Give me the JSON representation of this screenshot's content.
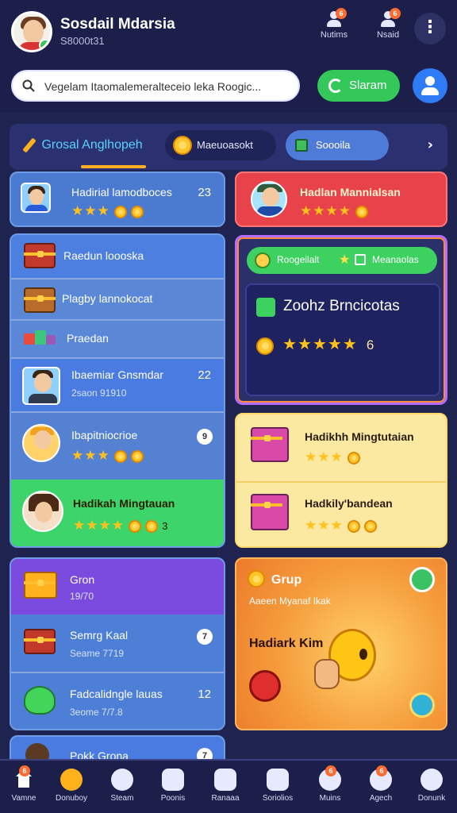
{
  "header": {
    "title": "Sosdail Mdarsia",
    "subtitle": "S8000t31",
    "actions": [
      {
        "label": "Nutims",
        "icon": "person-icon",
        "badge": "6"
      },
      {
        "label": "Nsaid",
        "icon": "person-icon",
        "badge": "6"
      }
    ],
    "more_icon": "⋮"
  },
  "search": {
    "placeholder": "Vegelam Itaomalemeralteceio leka Roogic...",
    "button_label": "Slaram"
  },
  "tabs": [
    {
      "label": "Grosal Anglhopeh"
    },
    {
      "label": "Maeuoasokt"
    },
    {
      "label": "Soooila"
    }
  ],
  "left_column": {
    "top_card": {
      "title": "Hadirial lamodboces",
      "count": "23"
    },
    "list_card": {
      "items": [
        {
          "label": "Raedun loooska"
        },
        {
          "label": "Plagby lannokocat"
        },
        {
          "label": "Praedan"
        },
        {
          "label": "Ibaemiar Gnsmdar",
          "sub": "2saon 91910",
          "count": "22"
        },
        {
          "label": "Ibapitniocrioe",
          "info": "9"
        },
        {
          "label": "Hadikah Mingtauan",
          "count": "3"
        }
      ]
    },
    "group_card": {
      "items": [
        {
          "label": "Gron",
          "sub": "19/70"
        },
        {
          "label": "Semrg Kaal",
          "sub": "Seame 7719",
          "info": "7"
        },
        {
          "label": "Fadcalidngle lauas",
          "sub": "3eome 7/7.8",
          "count": "12"
        }
      ]
    },
    "bottom_card": {
      "label": "Pokk Grona",
      "info": "7"
    }
  },
  "right_column": {
    "top_card": {
      "title": "Hadlan Mannialsan"
    },
    "feature_card": {
      "pill_left": "Roogeilalt",
      "pill_right": "Meanaolas",
      "title": "Zoohz Brncicotas",
      "rating_value": "6"
    },
    "yellow_card": {
      "items": [
        {
          "label": "Hadikhh Mingtutaian"
        },
        {
          "label": "Hadkily'bandean"
        }
      ]
    },
    "orange_card": {
      "title": "Grup",
      "subtitle": "Aaeen Myanaf Ikak",
      "caption": "Hadiark Kim"
    }
  },
  "bottom_nav": [
    {
      "label": "Vamne",
      "icon": "home-icon",
      "badge": "6"
    },
    {
      "label": "Donuboy",
      "icon": "donut-icon",
      "active": true
    },
    {
      "label": "Steam",
      "icon": "gamepad-icon"
    },
    {
      "label": "Poonis",
      "icon": "store-icon"
    },
    {
      "label": "Ranaaa",
      "icon": "gallery-icon"
    },
    {
      "label": "Soriolios",
      "icon": "game-icon"
    },
    {
      "label": "Muins",
      "icon": "chat-icon",
      "badge": "6"
    },
    {
      "label": "Agech",
      "icon": "person-icon",
      "badge": "6"
    },
    {
      "label": "Donunk",
      "icon": "emoji-icon"
    }
  ]
}
